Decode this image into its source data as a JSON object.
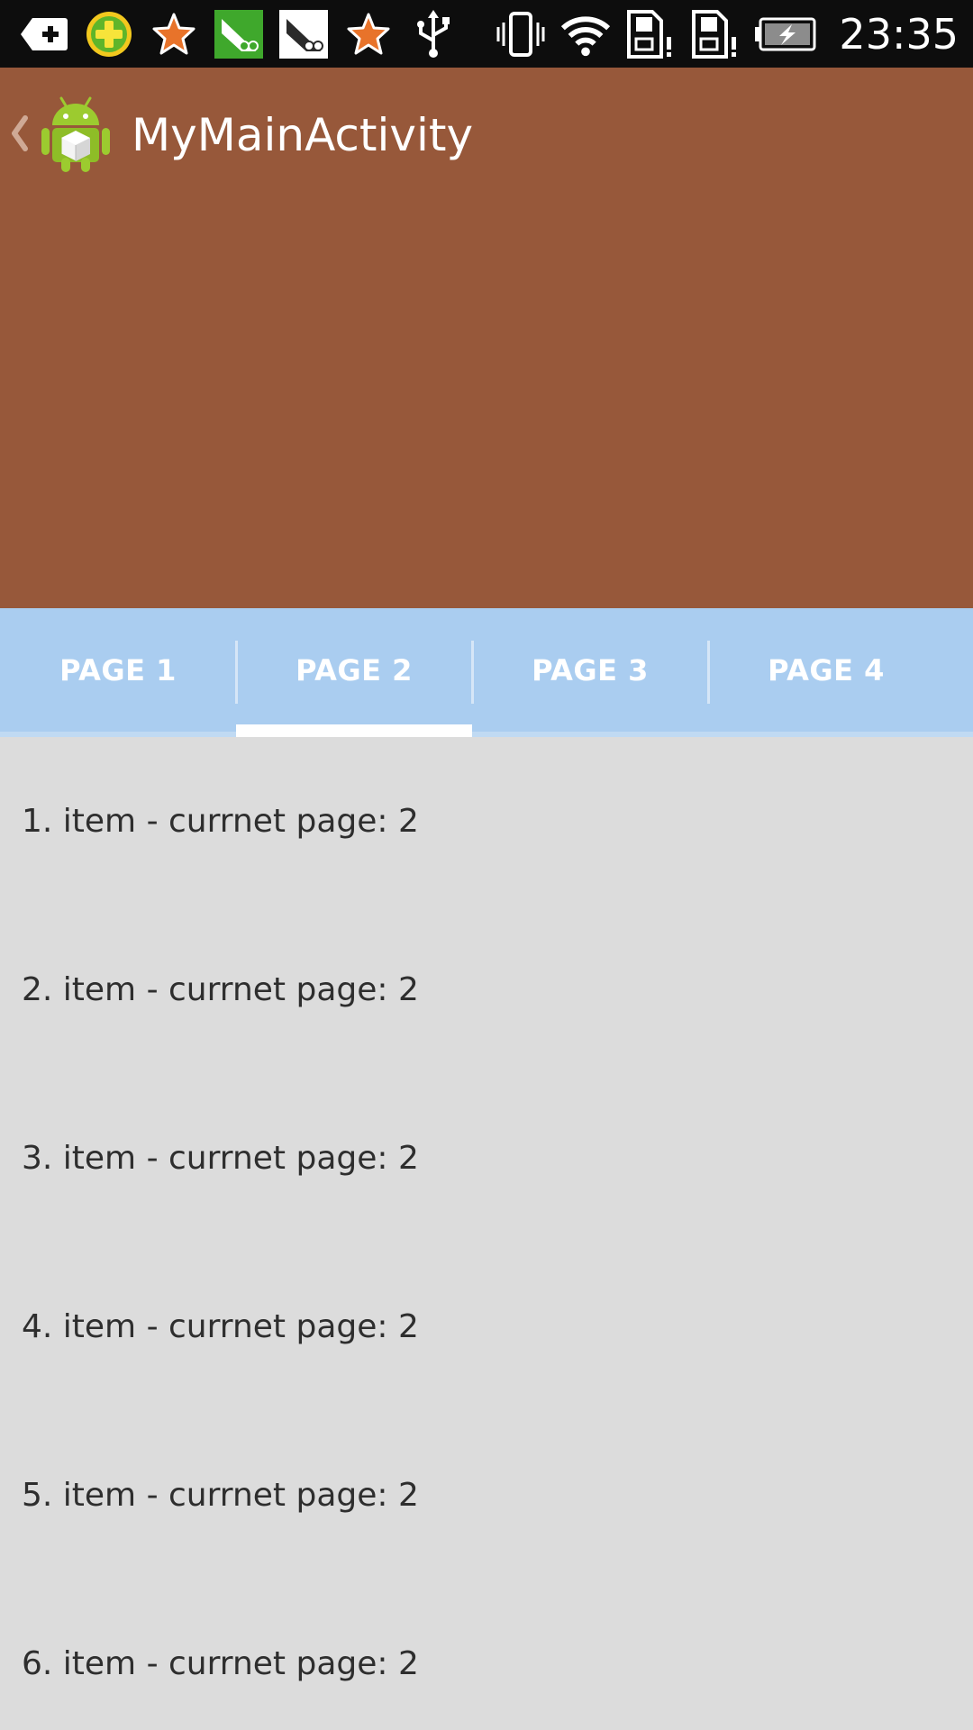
{
  "status_bar": {
    "time": "23:35",
    "icons": [
      "back-plus-icon",
      "360-security-icon",
      "star-notification-icon",
      "green-app-icon",
      "white-app-icon",
      "star-notification-icon",
      "usb-icon",
      "vibrate-icon",
      "wifi-icon",
      "sd-card-warning-icon",
      "sd-card-warning-icon",
      "battery-charging-icon"
    ]
  },
  "action_bar": {
    "title": "MyMainActivity",
    "background": "#97583a"
  },
  "tabs": {
    "background": "#aacdf0",
    "items": [
      {
        "label": "PAGE 1",
        "selected": false
      },
      {
        "label": "PAGE 2",
        "selected": true
      },
      {
        "label": "PAGE 3",
        "selected": false
      },
      {
        "label": "PAGE 4",
        "selected": false
      }
    ]
  },
  "list": {
    "items": [
      {
        "text": "1. item - currnet page: 2"
      },
      {
        "text": "2. item - currnet page: 2"
      },
      {
        "text": "3. item - currnet page: 2"
      },
      {
        "text": "4. item - currnet page: 2"
      },
      {
        "text": "5. item - currnet page: 2"
      },
      {
        "text": "6. item - currnet page: 2"
      }
    ]
  }
}
